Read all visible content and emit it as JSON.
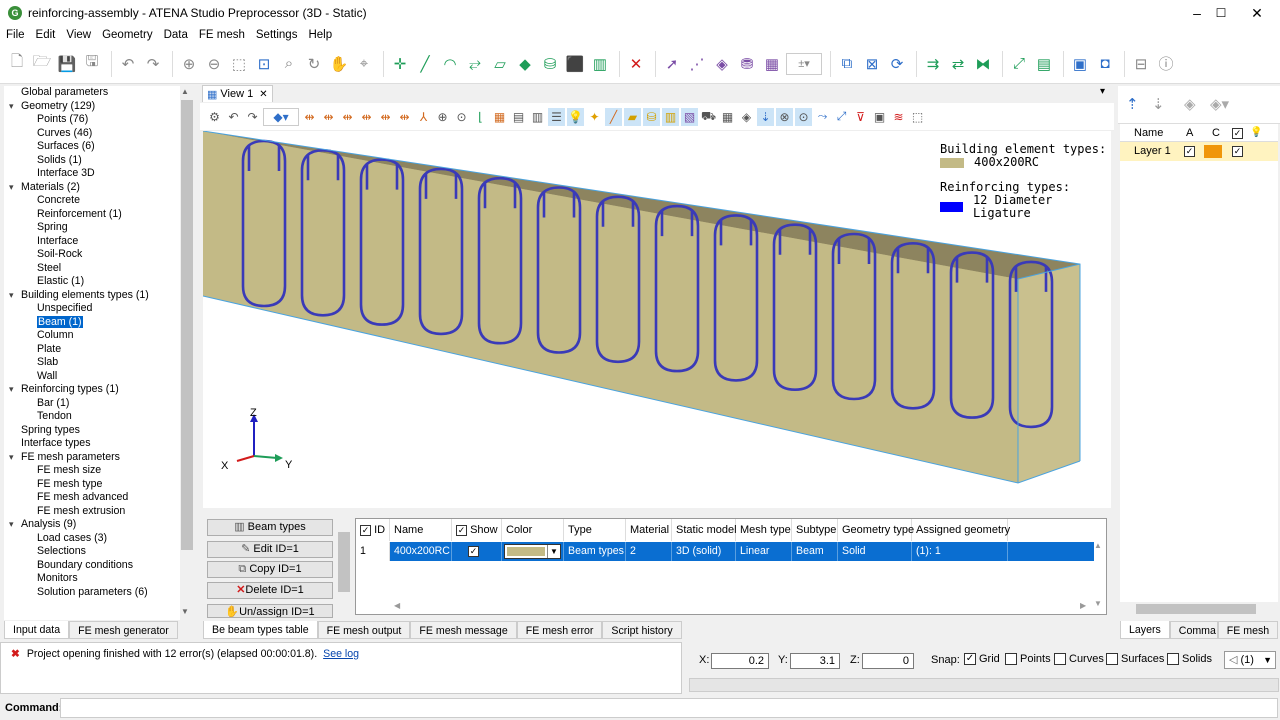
{
  "window": {
    "title": "reinforcing-assembly - ATENA Studio Preprocessor (3D - Static)",
    "minimize": "–",
    "maximize": "☐",
    "close": "✕"
  },
  "menu": [
    "File",
    "Edit",
    "View",
    "Geometry",
    "Data",
    "FE mesh",
    "Settings",
    "Help"
  ],
  "tree": {
    "items": [
      {
        "label": "Global parameters",
        "level": 0,
        "leaf": true
      },
      {
        "label": "Geometry (129)",
        "level": 0
      },
      {
        "label": "Points (76)",
        "level": 1
      },
      {
        "label": "Curves (46)",
        "level": 1
      },
      {
        "label": "Surfaces (6)",
        "level": 1
      },
      {
        "label": "Solids (1)",
        "level": 1
      },
      {
        "label": "Interface 3D",
        "level": 1
      },
      {
        "label": "Materials (2)",
        "level": 0
      },
      {
        "label": "Concrete",
        "level": 1
      },
      {
        "label": "Reinforcement (1)",
        "level": 1
      },
      {
        "label": "Spring",
        "level": 1
      },
      {
        "label": "Interface",
        "level": 1
      },
      {
        "label": "Soil-Rock",
        "level": 1
      },
      {
        "label": "Steel",
        "level": 1
      },
      {
        "label": "Elastic (1)",
        "level": 1
      },
      {
        "label": "Building elements types (1)",
        "level": 0
      },
      {
        "label": "Unspecified",
        "level": 1
      },
      {
        "label": "Beam (1)",
        "level": 1,
        "selected": true
      },
      {
        "label": "Column",
        "level": 1
      },
      {
        "label": "Plate",
        "level": 1
      },
      {
        "label": "Slab",
        "level": 1
      },
      {
        "label": "Wall",
        "level": 1
      },
      {
        "label": "Reinforcing types (1)",
        "level": 0
      },
      {
        "label": "Bar (1)",
        "level": 1
      },
      {
        "label": "Tendon",
        "level": 1
      },
      {
        "label": "Spring types",
        "level": 0,
        "leaf": true
      },
      {
        "label": "Interface types",
        "level": 0,
        "leaf": true
      },
      {
        "label": "FE mesh parameters",
        "level": 0
      },
      {
        "label": "FE mesh size",
        "level": 1
      },
      {
        "label": "FE mesh type",
        "level": 1
      },
      {
        "label": "FE mesh advanced",
        "level": 1
      },
      {
        "label": "FE mesh extrusion",
        "level": 1
      },
      {
        "label": "Analysis (9)",
        "level": 0
      },
      {
        "label": "Load cases (3)",
        "level": 1
      },
      {
        "label": "Selections",
        "level": 1
      },
      {
        "label": "Boundary conditions",
        "level": 1
      },
      {
        "label": "Monitors",
        "level": 1
      },
      {
        "label": "Solution parameters (6)",
        "level": 1
      }
    ],
    "tabs": [
      "Input data",
      "FE mesh generator"
    ]
  },
  "view": {
    "tab_label": "View 1",
    "close": "✕",
    "legend": {
      "building_header": "Building element types:",
      "building_item": "400x200RC",
      "building_color": "#c3ba86",
      "reinforcing_header": "Reinforcing types:",
      "reinforcing_item": "12 Diameter Ligature",
      "reinforcing_color": "#0000ff"
    },
    "axes": {
      "x": "X",
      "y": "Y",
      "z": "Z"
    }
  },
  "actions": {
    "beam_types": "Beam types",
    "edit": "Edit ID=1",
    "copy": "Copy ID=1",
    "delete": "Delete ID=1",
    "unassign": "Un/assign ID=1"
  },
  "table": {
    "headers": [
      "ID",
      "Name",
      "Show",
      "Color",
      "Type",
      "Material",
      "Static model",
      "Mesh type",
      "Subtype",
      "Geometry type",
      "Assigned geometry"
    ],
    "row": {
      "id": "1",
      "name": "400x200RC",
      "show": "✓",
      "color": "#c3ba86",
      "type": "Beam types",
      "material": "2",
      "static_model": "3D (solid)",
      "mesh_type": "Linear",
      "subtype": "Beam",
      "geometry_type": "Solid",
      "assigned": "(1): 1"
    }
  },
  "bottom_tabs": [
    "Be beam types table",
    "FE mesh output",
    "FE mesh message",
    "FE mesh error",
    "Script history"
  ],
  "layers": {
    "headers": [
      "Name",
      "A",
      "C"
    ],
    "row": {
      "name": "Layer 1",
      "active": "✓",
      "color": "#f0960a",
      "visible": "✓"
    },
    "tabs": [
      "Layers",
      "Comma",
      "FE mesh"
    ]
  },
  "status": {
    "message": "Project opening finished with 12 error(s) (elapsed 00:00:01.8).",
    "link": "See log",
    "icon": "✖"
  },
  "coords": {
    "x_label": "X:",
    "x": "0.2",
    "y_label": "Y:",
    "y": "3.1",
    "z_label": "Z:",
    "z": "0",
    "snap_label": "Snap:",
    "snaps": [
      {
        "label": "Grid",
        "checked": true
      },
      {
        "label": "Points",
        "checked": false
      },
      {
        "label": "Curves",
        "checked": false
      },
      {
        "label": "Surfaces",
        "checked": false
      },
      {
        "label": "Solids",
        "checked": false
      }
    ],
    "selector": "(1)"
  },
  "command": {
    "label": "Command:",
    "value": ""
  }
}
